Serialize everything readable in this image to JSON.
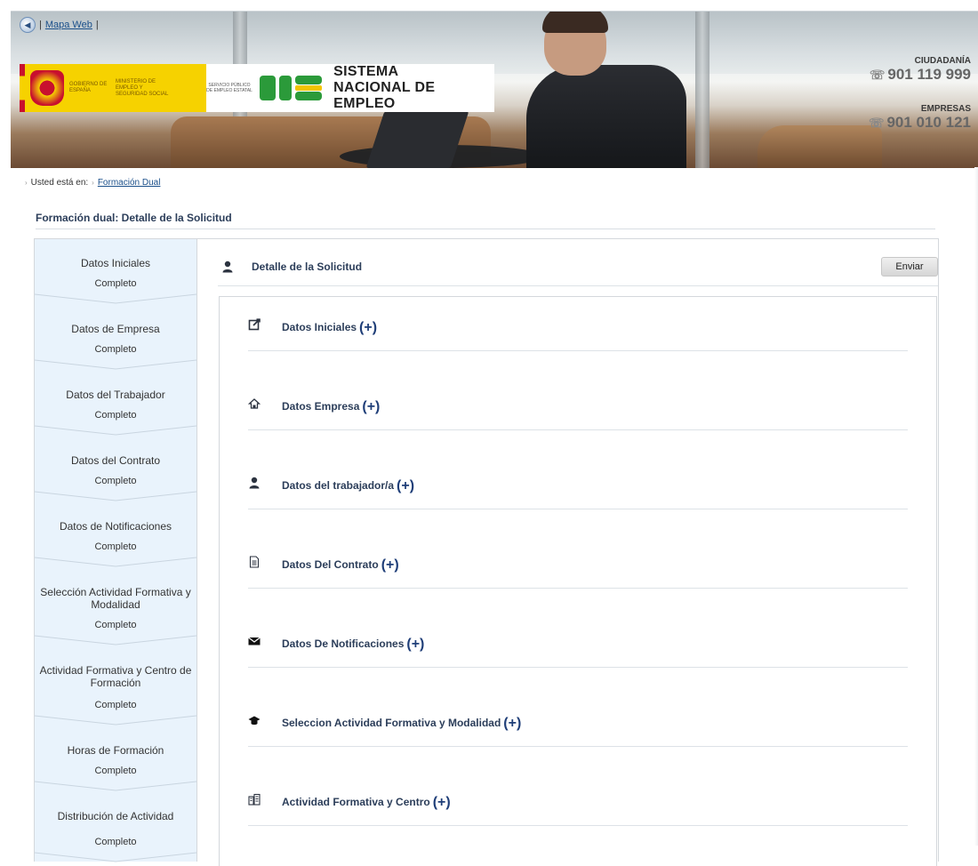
{
  "header": {
    "sitemap_link": "Mapa Web",
    "separator": "|",
    "gov_text": "GOBIERNO DE ESPAÑA",
    "ministry_text": "MINISTERIO DE EMPLEO Y SEGURIDAD SOCIAL",
    "sepe_text": "SERVICIO PÚBLICO DE EMPLEO ESTATAL",
    "sne_line1": "SISTEMA",
    "sne_line2": "NACIONAL DE EMPLEO",
    "contacts": [
      {
        "label": "CIUDADANÍA",
        "number": "901 119 999"
      },
      {
        "label": "EMPRESAS",
        "number": "901 010 121"
      }
    ]
  },
  "breadcrumb": {
    "prefix": "Usted está en:",
    "link": "Formación Dual"
  },
  "page_title": "Formación dual: Detalle de la Solicitud",
  "steps": [
    {
      "title": "Datos Iniciales",
      "status": "Completo"
    },
    {
      "title": "Datos de Empresa",
      "status": "Completo"
    },
    {
      "title": "Datos del Trabajador",
      "status": "Completo"
    },
    {
      "title": "Datos del Contrato",
      "status": "Completo"
    },
    {
      "title": "Datos de Notificaciones",
      "status": "Completo"
    },
    {
      "title": "Selección Actividad Formativa y Modalidad",
      "status": "Completo"
    },
    {
      "title": "Actividad Formativa y Centro de Formación",
      "status": "Completo"
    },
    {
      "title": "Horas de Formación",
      "status": "Completo"
    },
    {
      "title": "Distribución de Actividad",
      "status": "Completo"
    }
  ],
  "main": {
    "heading": "Detalle de la Solicitud",
    "send_label": "Enviar",
    "expand_symbol": "(+)",
    "sections": [
      {
        "label": "Datos Iniciales",
        "icon": "edit-icon"
      },
      {
        "label": "Datos Empresa",
        "icon": "home-icon"
      },
      {
        "label": "Datos del trabajador/a",
        "icon": "user-icon"
      },
      {
        "label": "Datos Del Contrato",
        "icon": "document-icon"
      },
      {
        "label": "Datos De Notificaciones",
        "icon": "envelope-icon"
      },
      {
        "label": "Seleccion Actividad Formativa y Modalidad",
        "icon": "graduation-cap-icon"
      },
      {
        "label": "Actividad Formativa y Centro",
        "icon": "building-icon"
      }
    ]
  }
}
